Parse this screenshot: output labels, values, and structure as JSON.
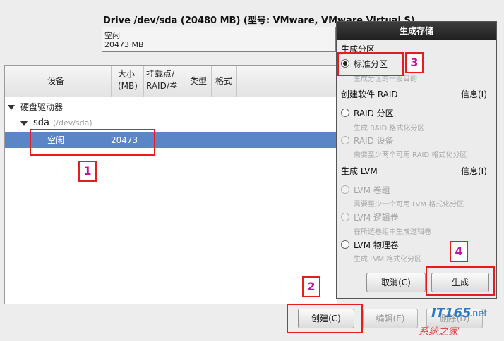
{
  "drive": {
    "title": "Drive /dev/sda (20480 MB) (型号: VMware, VMware Virtual S)",
    "bar_line1": "空闲",
    "bar_line2": "20473 MB"
  },
  "table": {
    "columns": [
      "设备",
      "大小\n(MB)",
      "挂载点/\nRAID/卷",
      "类型",
      "格式"
    ],
    "rows": {
      "hard_drives": "硬盘驱动器",
      "sda": "sda",
      "sda_path": "(/dev/sda)",
      "free_label": "空闲",
      "free_size": "20473"
    }
  },
  "buttons": {
    "create": "创建(C)",
    "edit": "编辑(E)",
    "delete": "删除(D)"
  },
  "dialog": {
    "title": "生成存储",
    "section_partition": "生成分区",
    "standard_partition": "标准分区",
    "standard_partition_desc": "生成分区的一般目的",
    "section_raid": "创建软件 RAID",
    "info_raid": "信息(I)",
    "raid_partition": "RAID 分区",
    "raid_partition_desc": "生成 RAID 格式化分区",
    "raid_device": "RAID 设备",
    "raid_device_desc": "需要至少两个可用 RAID 格式化分区",
    "section_lvm": "生成 LVM",
    "info_lvm": "信息(I)",
    "lvm_vg": "LVM 卷组",
    "lvm_vg_desc": "需要至少一个可用 LVM 格式化分区",
    "lvm_lv": "LVM 逻辑卷",
    "lvm_lv_desc": "在所选卷组中生成逻辑卷",
    "lvm_pv": "LVM 物理卷",
    "lvm_pv_desc": "生成 LVM 格式化分区",
    "cancel": "取消(C)",
    "create": "生成"
  },
  "annotations": [
    "1",
    "2",
    "3",
    "4"
  ],
  "watermark": {
    "brand": "IT165",
    "tld": ".net",
    "sub": "系统之家"
  },
  "colors": {
    "selection": "#5a86c8",
    "annotation_red": "#e41e1e",
    "annotation_number": "#c0169f",
    "dialog_title": "#2a2a2a"
  }
}
